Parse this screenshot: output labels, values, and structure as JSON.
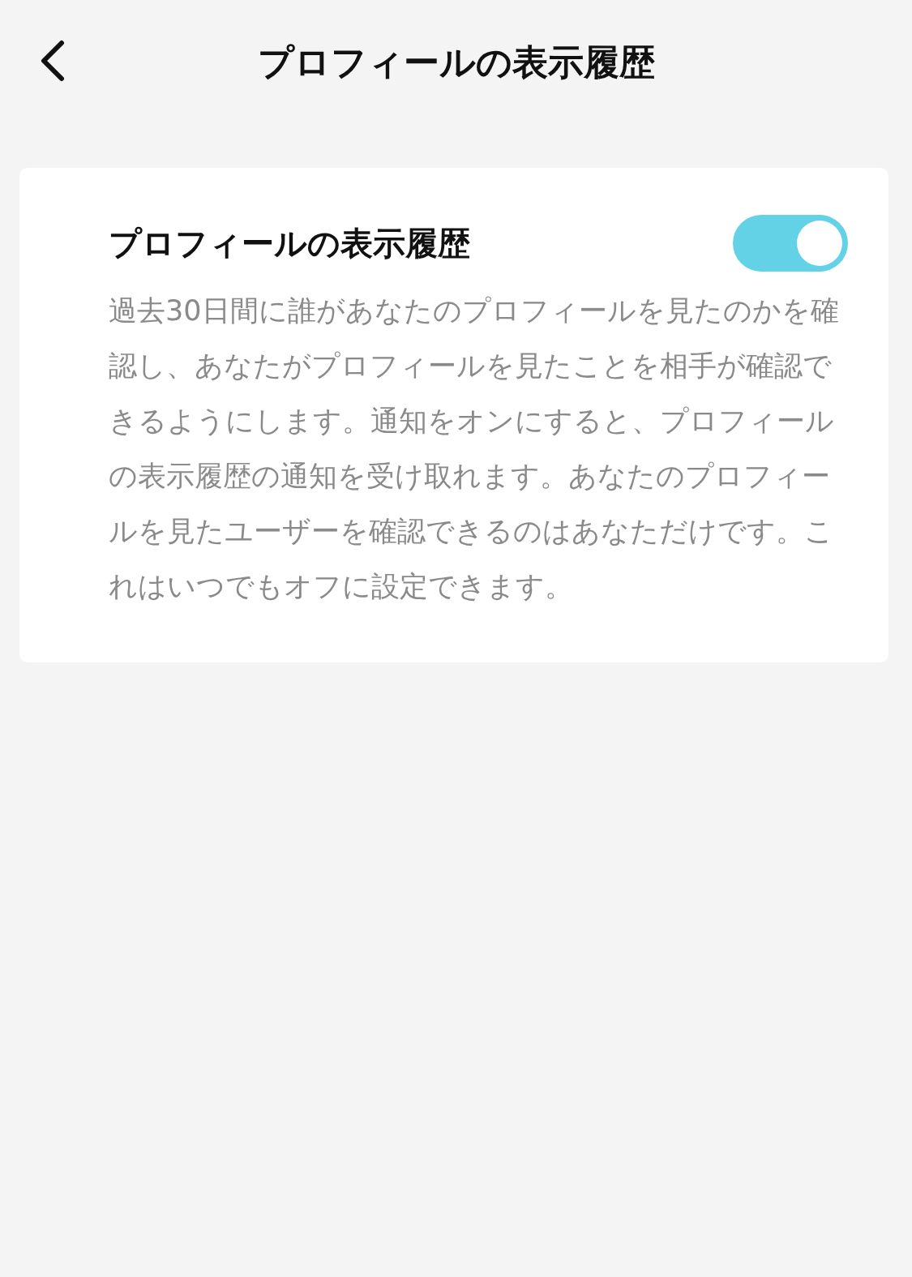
{
  "header": {
    "title": "プロフィールの表示履歴"
  },
  "setting": {
    "title": "プロフィールの表示履歴",
    "on": true,
    "description": "過去30日間に誰があなたのプロフィールを見たのかを確認し、あなたがプロフィールを見たことを相手が確認できるようにします。通知をオンにすると、プロフィールの表示履歴の通知を受け取れます。あなたのプロフィールを見たユーザーを確認できるのはあなただけです。これはいつでもオフに設定できます。"
  }
}
